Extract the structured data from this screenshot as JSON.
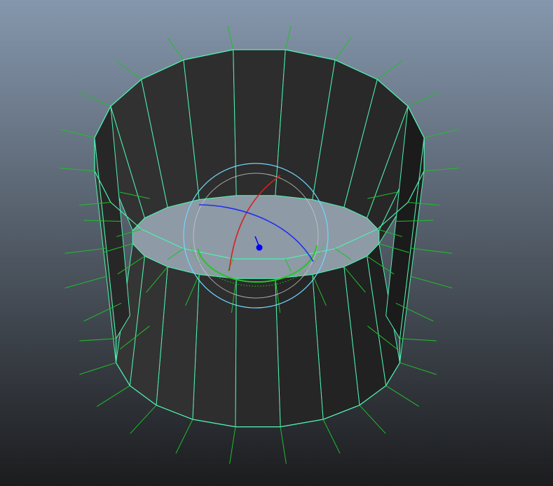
{
  "viewport": {
    "panel": "3d-perspective-viewport",
    "background_top": "#8597ad",
    "background_bottom": "#1b1c1e"
  },
  "mesh": {
    "type": "cylinder",
    "state": "selected",
    "segments": 20,
    "cap": "bottom-only",
    "wire_color": "#4ff0b0",
    "normal_color": "#1fbf2a",
    "face_dark": "#1e1e1e",
    "face_light": "#3a3a3a",
    "inner_floor_color": "#8e9aa6"
  },
  "manipulator": {
    "tool": "rotate",
    "icon": "rotate-manipulator-icon",
    "x_ring_color": "#d81f1f",
    "y_ring_color": "#27c427",
    "z_ring_color": "#1f2ff0",
    "view_ring_color": "#6fd8ff",
    "trackball_color": "#c8c8c8",
    "pivot_color": "#0000ff"
  }
}
